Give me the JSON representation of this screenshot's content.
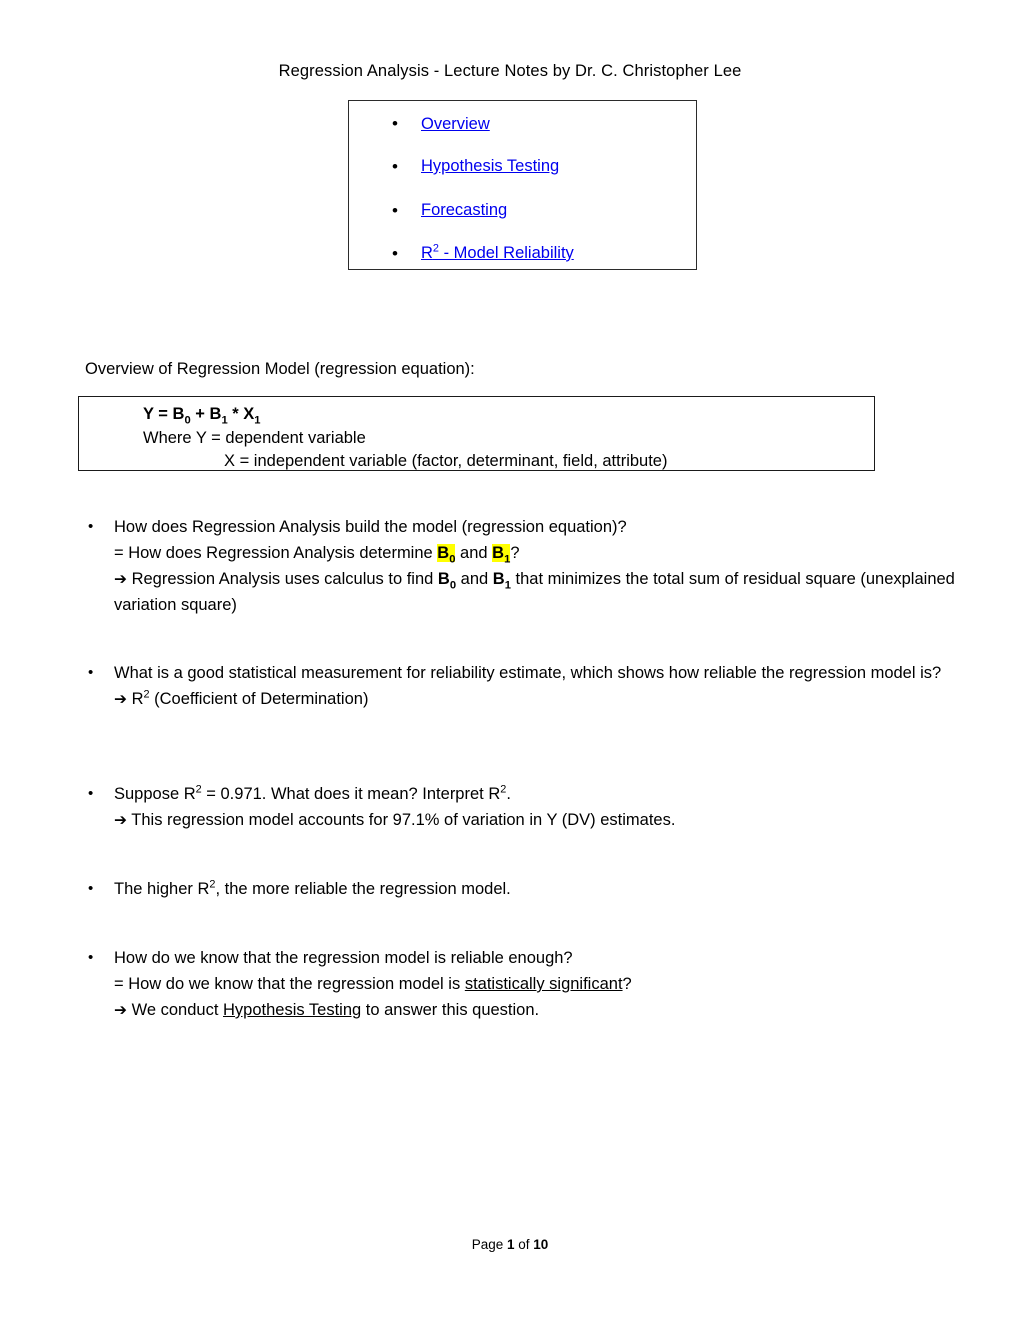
{
  "document": {
    "title": "Regression Analysis - Lecture Notes by Dr. C. Christopher Lee",
    "link_color": "#0000EE",
    "highlight_color": "#FFFF00"
  },
  "links_box": {
    "items": [
      {
        "label": "Overview",
        "has_superscript": false
      },
      {
        "label": "Hypothesis Testing",
        "has_superscript": false
      },
      {
        "label": "Forecasting",
        "has_superscript": false
      },
      {
        "label_prefix": "R",
        "superscript": "2",
        "label_suffix": " -  Model Reliability"
      }
    ],
    "bullet_glyph": "•"
  },
  "section": {
    "intro": "Overview of Regression Model (regression equation):"
  },
  "equation_box": {
    "line1": {
      "y": "Y",
      "eq": " =  ",
      "b0": "B",
      "b0_sub": "0",
      "plus": "  +  ",
      "b1": "B",
      "b1_sub": "1",
      "mult": " * ",
      "x1": "X",
      "x1_sub": "1"
    },
    "line2": "Where Y = dependent variable",
    "line3": "X = independent variable (factor, determinant, field, attribute)"
  },
  "bullets": {
    "b1": {
      "line1": "How does Regression Analysis build the model (regression equation)?",
      "line2_pre": "= How does Regression Analysis determine ",
      "line2_hl1": "B",
      "line2_hl1_sub": "0",
      "line2_mid": " and ",
      "line2_hl2": "B",
      "line2_hl2_sub": "1",
      "line2_post": "?",
      "line3_arrow": "➔",
      "line3_pre": " Regression Analysis uses calculus to find ",
      "line3_b0": "B",
      "line3_b0_sub": "0",
      "line3_mid": "  and  ",
      "line3_b1": "B",
      "line3_b1_sub": "1",
      "line3_post": " that minimizes the total sum of residual square (unexplained variation square)"
    },
    "b2": {
      "line1": "What is a good statistical measurement for reliability estimate, which shows how reliable the regression model is?",
      "line2_arrow": "➔",
      "line2_pre": " R",
      "line2_sup": "2",
      "line2_post": "   (Coefficient of Determination)"
    },
    "b3": {
      "line1_pre": "Suppose R",
      "line1_sup1": "2",
      "line1_mid": " = 0.971.  What does it mean?  Interpret R",
      "line1_sup2": "2",
      "line1_post": ".",
      "line2_arrow": "➔",
      "line2_text": " This regression model accounts for 97.1% of variation in Y (DV) estimates."
    },
    "b4": {
      "line1_pre": "The higher R",
      "line1_sup": "2",
      "line1_post": ", the more reliable the regression model."
    },
    "b5": {
      "line1": "How do we know that the regression model is reliable enough?",
      "line2_pre": "= How do we know that the regression model is ",
      "line2_u": "statistically significant",
      "line2_post": "?",
      "line3_arrow": "➔",
      "line3_pre": " We conduct ",
      "line3_u": "Hypothesis Testing",
      "line3_post": " to answer this question."
    }
  },
  "footer": {
    "pre": "Page ",
    "current": "1",
    "mid": " of ",
    "total": "10"
  }
}
